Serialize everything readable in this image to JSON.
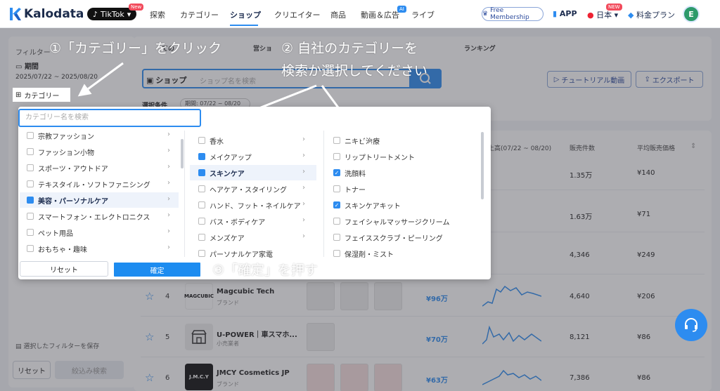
{
  "nav": {
    "logo": "Kalodata",
    "platform": "TikTok",
    "platform_badge": "New",
    "items": [
      "探索",
      "カテゴリー",
      "ショップ",
      "クリエイター",
      "商品",
      "動画＆広告",
      "ライブ"
    ],
    "ai_badge": "AI",
    "free_membership": "Free Membership",
    "app": "APP",
    "language": "日本",
    "lang_badge": "NEW",
    "plan": "料金プラン",
    "avatar": "E"
  },
  "sidebar": {
    "filter_title": "フィルター",
    "period_label": "期間",
    "period_value": "2025/07/22 ~ 2025/08/20",
    "category_label": "カテゴリー",
    "save_filter": "選択したフィルターを保存",
    "reset": "リセット",
    "search": "絞込み検索"
  },
  "main": {
    "breadcrumb_1": "ての",
    "breadcrumb_2": "営ショ",
    "breadcrumb_3": "ランキング",
    "shop_label": "ショップ",
    "shop_placeholder": "ショップ名を検索",
    "tutorial": "チュートリアル動画",
    "export": "エクスポート",
    "conditions": "選択条件",
    "cond_chip": "期間: 07/22 ~ 08/20"
  },
  "table": {
    "headers": [
      "上高(07/22 ~ 08/20)",
      "販売件数",
      "平均販売価格"
    ],
    "rows": [
      {
        "rank": "",
        "name": "",
        "type": "",
        "revenue": "",
        "sales": "1.35万",
        "price": "¥140"
      },
      {
        "rank": "",
        "name": "",
        "type": "",
        "revenue": "",
        "sales": "1.63万",
        "price": "¥71"
      },
      {
        "rank": "",
        "name": "",
        "type": "",
        "revenue": "",
        "sales": "4,346",
        "price": "¥249"
      },
      {
        "rank": "4",
        "name": "Magcubic Tech",
        "type": "ブランド",
        "logo": "MAGCUBIC",
        "revenue": "¥96万",
        "sales": "4,640",
        "price": "¥206"
      },
      {
        "rank": "5",
        "name": "U-POWER｜車スマホ...",
        "type": "小売業者",
        "logo": "",
        "revenue": "¥70万",
        "sales": "8,121",
        "price": "¥86"
      },
      {
        "rank": "6",
        "name": "JMCY Cosmetics JP",
        "type": "ブランド",
        "logo": "J.M.C.Y",
        "revenue": "¥63万",
        "sales": "7,386",
        "price": "¥86"
      }
    ]
  },
  "dropdown": {
    "search_placeholder": "カテゴリー名を検索",
    "col1": [
      "宗教ファッション",
      "ファッション小物",
      "スポーツ・アウトドア",
      "テキスタイル・ソフトファニシング",
      "美容・パーソナルケア",
      "スマートフォン・エレクトロニクス",
      "ペット用品",
      "おもちゃ・趣味"
    ],
    "col2": [
      "香水",
      "メイクアップ",
      "スキンケア",
      "ヘアケア・スタイリング",
      "ハンド、フット・ネイルケア",
      "バス・ボディケア",
      "メンズケア",
      "パーソナルケア家電"
    ],
    "col3": [
      "ニキビ治療",
      "リップトリートメント",
      "洗顔料",
      "トナー",
      "スキンケアキット",
      "フェイシャルマッサージクリーム",
      "フェイススクラブ・ピーリング",
      "保湿剤・ミスト"
    ],
    "reset": "リセット",
    "confirm": "確定"
  },
  "instructions": {
    "step1": "①「カテゴリー」をクリック",
    "step2a": "② 自社のカテゴリーを",
    "step2b": "検索か選択してください",
    "step3": "③「確定」を押す"
  },
  "colors": {
    "accent": "#2d8cf0",
    "navy": "#1d2d50"
  }
}
